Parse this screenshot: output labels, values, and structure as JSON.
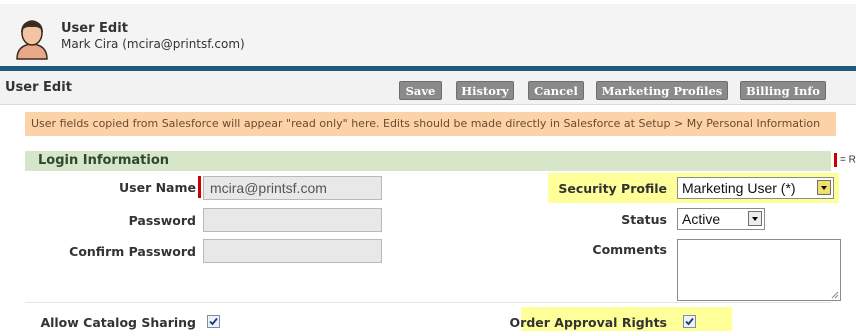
{
  "header": {
    "title": "User Edit",
    "subtitle": "Mark Cira (mcira@printsf.com)",
    "avatar_icon": "user-avatar-icon"
  },
  "toolbar": {
    "section_title": "User Edit",
    "buttons": {
      "save": "Save",
      "history": "History",
      "cancel": "Cancel",
      "marketing_profiles": "Marketing Profiles",
      "billing_info": "Billing Info"
    }
  },
  "notice": "User fields copied from Salesforce will appear \"read only\" here. Edits should be made directly in Salesforce at Setup > My Personal Information",
  "login_section": {
    "title": "Login Information",
    "required_legend": "= R"
  },
  "form": {
    "user_name": {
      "label": "User Name",
      "value": "mcira@printsf.com"
    },
    "password": {
      "label": "Password",
      "value": ""
    },
    "confirm_password": {
      "label": "Confirm Password",
      "value": ""
    },
    "security_profile": {
      "label": "Security Profile",
      "value": "Marketing User (*)"
    },
    "status": {
      "label": "Status",
      "value": "Active"
    },
    "comments": {
      "label": "Comments",
      "value": ""
    },
    "allow_catalog_sharing": {
      "label": "Allow Catalog Sharing",
      "checked": true
    },
    "order_approval_rights": {
      "label": "Order Approval Rights",
      "checked": true
    }
  },
  "colors": {
    "header_bar": "#1f5a7c",
    "button": "#8a8a8a",
    "notice_bg": "#fcd3a9",
    "section_bg": "#d7e5c9",
    "highlight": "#ffff99",
    "required": "#cc0000"
  }
}
